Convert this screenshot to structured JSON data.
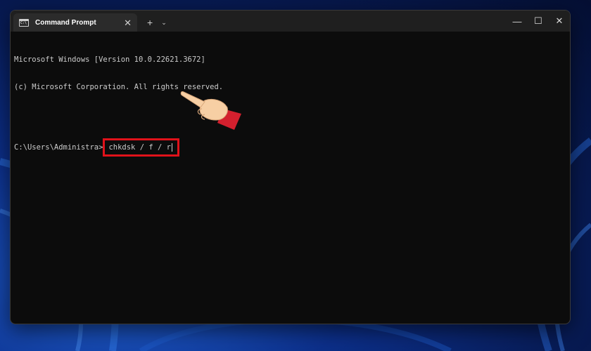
{
  "window": {
    "tab_title": "Command Prompt",
    "tab_icon_text": "C:\\",
    "tab_icon": "cmd-icon",
    "close_tab_glyph": "✕",
    "new_tab_glyph": "+",
    "dropdown_glyph": "⌄",
    "minimize_glyph": "—",
    "maximize_glyph": "☐",
    "close_glyph": "✕"
  },
  "console": {
    "line1": "Microsoft Windows [Version 10.0.22621.3672]",
    "line2": "(c) Microsoft Corporation. All rights reserved.",
    "prompt": "C:\\Users\\Administra>",
    "command": "chkdsk / f / r"
  },
  "annotation": {
    "highlight_color": "#e0121a",
    "pointer_icon": "pointing-hand-icon"
  }
}
